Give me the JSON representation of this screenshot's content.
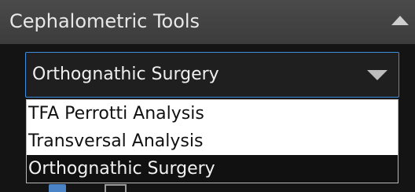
{
  "panel": {
    "title": "Cephalometric Tools",
    "collapse_icon": "triangle-up-icon"
  },
  "analysis_select": {
    "value": "Orthognathic Surgery",
    "expand_icon": "chevron-down-icon",
    "accent_color": "#3e8ee0",
    "options": [
      {
        "label": "TFA Perrotti Analysis",
        "selected": false
      },
      {
        "label": "Transversal Analysis",
        "selected": false
      },
      {
        "label": "Orthognathic Surgery",
        "selected": true
      }
    ]
  },
  "toolbar": {
    "icons": [
      "tool-icon-blue",
      "tool-icon-frame"
    ]
  }
}
